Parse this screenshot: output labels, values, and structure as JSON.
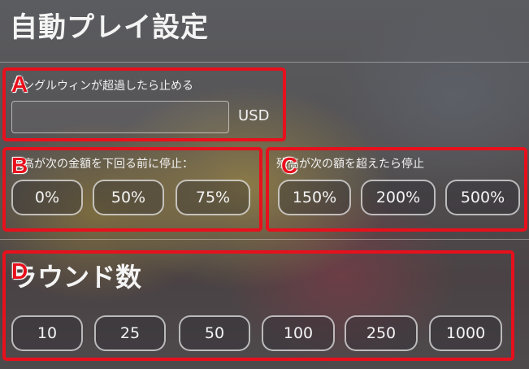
{
  "title": "自動プレイ設定",
  "single_win": {
    "label": "シングルウィンが超過したら止める",
    "value": "",
    "unit": "USD"
  },
  "loss_limit": {
    "label": "残高が次の金額を下回る前に停止：",
    "options": [
      "0%",
      "50%",
      "75%"
    ]
  },
  "win_limit": {
    "label": "残高が次の額を超えたら停止",
    "options": [
      "150%",
      "200%",
      "500%"
    ]
  },
  "rounds": {
    "label": "ラウンド数",
    "options": [
      "10",
      "25",
      "50",
      "100",
      "250",
      "1000"
    ]
  },
  "annotations": {
    "a": "A",
    "b": "B",
    "c": "C",
    "d": "D"
  },
  "colors": {
    "annotation_red": "#e8101c",
    "chip_border": "#d9d9d9"
  }
}
